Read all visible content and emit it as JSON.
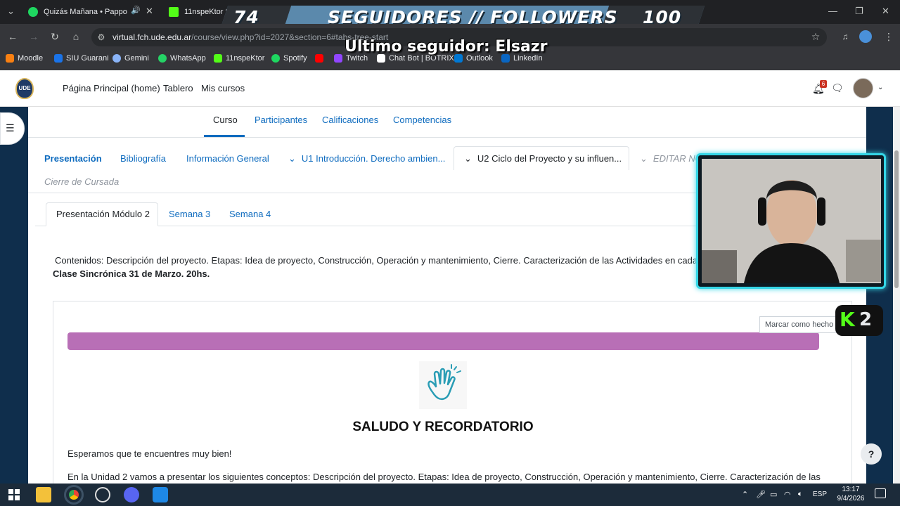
{
  "browser": {
    "tabs": [
      {
        "title": "Quizás Mañana • Pappo",
        "favicon_color": "#1ed760"
      },
      {
        "title": "11nspeKtor St",
        "favicon_color": "#53fc18"
      }
    ],
    "url_host": "virtual.fch.ude.edu.ar",
    "url_path": "/course/view.php?id=2027&section=6#tabs-tree-start",
    "bookmarks": [
      {
        "label": "Moodle",
        "color": "#f98012"
      },
      {
        "label": "SIU Guarani",
        "color": "#1a73e8"
      },
      {
        "label": "Gemini",
        "color": "#8ab4f8"
      },
      {
        "label": "WhatsApp",
        "color": "#25d366"
      },
      {
        "label": "11nspeKtor",
        "color": "#53fc18"
      },
      {
        "label": "Spotify",
        "color": "#1ed760"
      },
      {
        "label": "",
        "color": "#ff0000"
      },
      {
        "label": "Twitch",
        "color": "#9146ff"
      },
      {
        "label": "Chat Bot | BOTRIX",
        "color": "#ffffff"
      },
      {
        "label": "Outlook",
        "color": "#0078d4"
      },
      {
        "label": "LinkedIn",
        "color": "#0a66c2"
      }
    ]
  },
  "overlay": {
    "followers_current": "74",
    "followers_title": "SEGUIDORES // FOLLOWERS",
    "followers_goal": "100",
    "last_follower": "Ultimo seguidor: Elsazr",
    "badge": "K2"
  },
  "moodle": {
    "logo": "UDE",
    "nav": [
      "Página Principal (home)",
      "Tablero",
      "Mis cursos"
    ],
    "notification_count": "6",
    "secondary_nav": [
      {
        "label": "Curso",
        "active": true
      },
      {
        "label": "Participantes",
        "active": false
      },
      {
        "label": "Calificaciones",
        "active": false
      },
      {
        "label": "Competencias",
        "active": false
      }
    ],
    "course_tabs": [
      {
        "label": "Presentación"
      },
      {
        "label": "Bibliografía"
      },
      {
        "label": "Información General"
      },
      {
        "label": "U1 Introducción. Derecho ambien..."
      },
      {
        "label": "U2 Ciclo del Proyecto y su influen..."
      },
      {
        "label": "EDITAR NO"
      },
      {
        "label": "Cierre de Cursada"
      }
    ],
    "sub_tabs": [
      "Presentación Módulo 2",
      "Semana 3",
      "Semana 4"
    ],
    "contenidos": "Contenidos: Descripción del proyecto. Etapas: Idea de proyecto, Construcción, Operación y mantenimiento, Cierre. Caracterización de las Actividades en cada etapa.",
    "clase": "Clase Sincrónica 31 de Marzo. 20hs.",
    "marcar_button": "Marcar como hecho",
    "accent_color": "#b86fb6",
    "saludo_title": "SALUDO Y RECORDATORIO",
    "esperamos": "Esperamos que te encuentres muy bien!",
    "unidad_text": "En la Unidad  2 vamos a presentar los siguientes conceptos: Descripción del proyecto. Etapas: Idea de proyecto, Construcción, Operación y mantenimiento, Cierre. Caracterización de las",
    "help": "?"
  },
  "taskbar": {
    "language": "ESP",
    "time": "13:17",
    "date": "9/4/2026"
  }
}
